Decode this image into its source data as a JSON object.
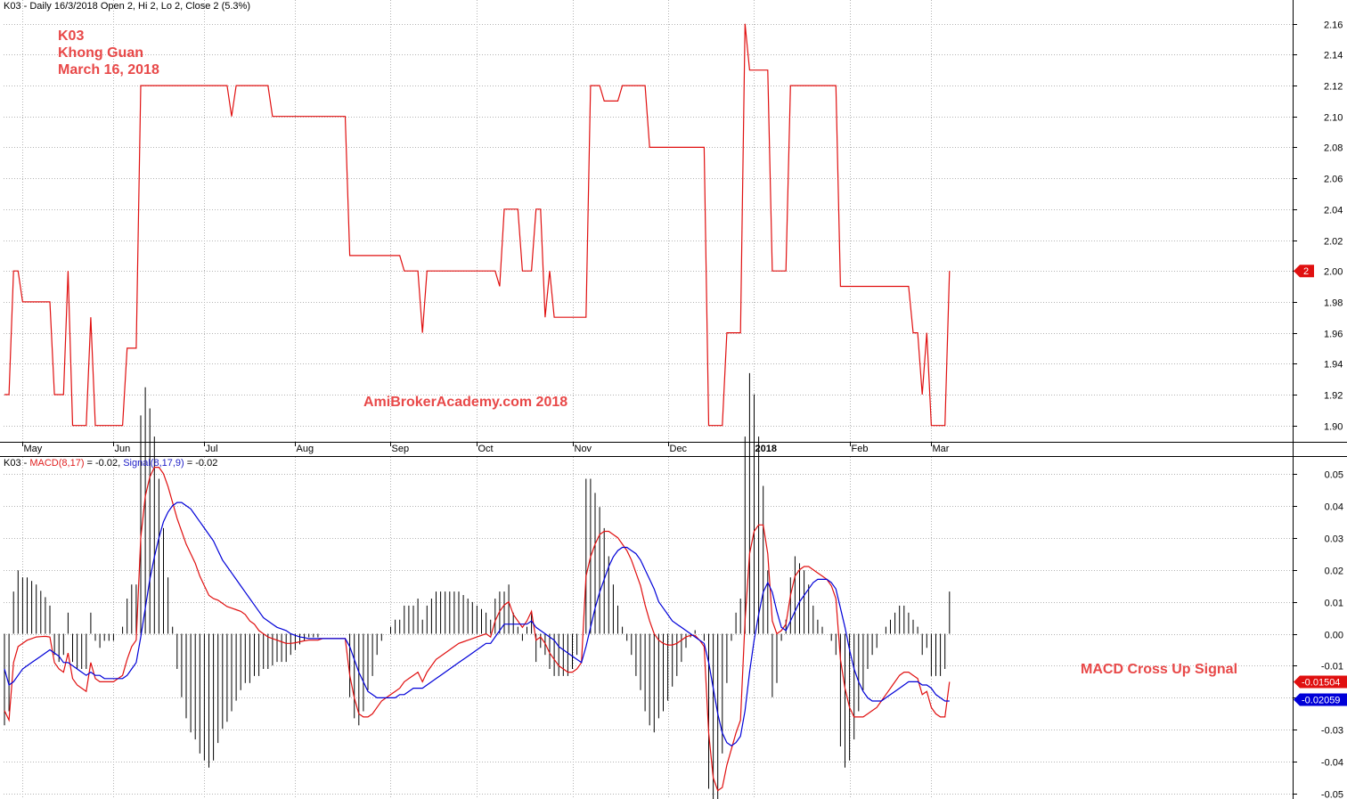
{
  "price_header": {
    "symbol": "K03",
    "info": " - Daily 16/3/2018 Open 2, Hi 2, Lo 2, Close 2 (5.3%)"
  },
  "annotation": {
    "line1": "K03",
    "line2": "Khong Guan",
    "line3": "March 16, 2018",
    "watermark": "AmiBrokerAcademy.com  2018",
    "signal": "MACD Cross Up Signal"
  },
  "macd_header": {
    "symbol": "K03",
    "sep1": " - ",
    "macd_label": "MACD(8,17)",
    "macd_value": " = -0.02, ",
    "signal_label": "Signal(8,17,9)",
    "signal_value": " = -0.02"
  },
  "colors": {
    "price": "#e01010",
    "macd": "#e01010",
    "signal": "#0000d8",
    "histogram": "#000000",
    "grid": "#b4b4b4",
    "last_price_tag": "#e01010",
    "last_signal_tag": "#0000d8"
  },
  "chart_data": [
    {
      "type": "line",
      "name": "price",
      "ylim": [
        1.89,
        2.165
      ],
      "yticks": [
        "1.90",
        "1.92",
        "1.94",
        "1.96",
        "1.98",
        "2.00",
        "2.02",
        "2.04",
        "2.06",
        "2.08",
        "2.10",
        "2.12",
        "2.14",
        "2.16"
      ],
      "months": [
        {
          "label": "May",
          "bar": 4,
          "bold": false
        },
        {
          "label": "Jun",
          "bar": 24,
          "bold": false
        },
        {
          "label": "Jul",
          "bar": 44,
          "bold": false
        },
        {
          "label": "Aug",
          "bar": 64,
          "bold": false
        },
        {
          "label": "Sep",
          "bar": 85,
          "bold": false
        },
        {
          "label": "Oct",
          "bar": 104,
          "bold": false
        },
        {
          "label": "Nov",
          "bar": 125,
          "bold": false
        },
        {
          "label": "Dec",
          "bar": 146,
          "bold": false
        },
        {
          "label": "2018",
          "bar": 165,
          "bold": true
        },
        {
          "label": "Feb",
          "bar": 186,
          "bold": false
        },
        {
          "label": "Mar",
          "bar": 204,
          "bold": false
        }
      ],
      "last_value_label": "2",
      "last_value": 2.0,
      "values": [
        1.92,
        1.92,
        2.0,
        2.0,
        1.98,
        1.98,
        1.98,
        1.98,
        1.98,
        1.98,
        1.98,
        1.92,
        1.92,
        1.92,
        2.0,
        1.9,
        1.9,
        1.9,
        1.9,
        1.97,
        1.9,
        1.9,
        1.9,
        1.9,
        1.9,
        1.9,
        1.9,
        1.95,
        1.95,
        1.95,
        2.12,
        2.12,
        2.12,
        2.12,
        2.12,
        2.12,
        2.12,
        2.12,
        2.12,
        2.12,
        2.12,
        2.12,
        2.12,
        2.12,
        2.12,
        2.12,
        2.12,
        2.12,
        2.12,
        2.12,
        2.1,
        2.12,
        2.12,
        2.12,
        2.12,
        2.12,
        2.12,
        2.12,
        2.12,
        2.1,
        2.1,
        2.1,
        2.1,
        2.1,
        2.1,
        2.1,
        2.1,
        2.1,
        2.1,
        2.1,
        2.1,
        2.1,
        2.1,
        2.1,
        2.1,
        2.1,
        2.01,
        2.01,
        2.01,
        2.01,
        2.01,
        2.01,
        2.01,
        2.01,
        2.01,
        2.01,
        2.01,
        2.01,
        2.0,
        2.0,
        2.0,
        2.0,
        1.96,
        2.0,
        2.0,
        2.0,
        2.0,
        2.0,
        2.0,
        2.0,
        2.0,
        2.0,
        2.0,
        2.0,
        2.0,
        2.0,
        2.0,
        2.0,
        2.0,
        1.99,
        2.04,
        2.04,
        2.04,
        2.04,
        2.0,
        2.0,
        2.0,
        2.04,
        2.04,
        1.97,
        2.0,
        1.97,
        1.97,
        1.97,
        1.97,
        1.97,
        1.97,
        1.97,
        1.97,
        2.12,
        2.12,
        2.12,
        2.11,
        2.11,
        2.11,
        2.11,
        2.12,
        2.12,
        2.12,
        2.12,
        2.12,
        2.12,
        2.08,
        2.08,
        2.08,
        2.08,
        2.08,
        2.08,
        2.08,
        2.08,
        2.08,
        2.08,
        2.08,
        2.08,
        2.08,
        1.9,
        1.9,
        1.9,
        1.9,
        1.96,
        1.96,
        1.96,
        1.96,
        2.16,
        2.13,
        2.13,
        2.13,
        2.13,
        2.13,
        2.0,
        2.0,
        2.0,
        2.0,
        2.12,
        2.12,
        2.12,
        2.12,
        2.12,
        2.12,
        2.12,
        2.12,
        2.12,
        2.12,
        2.12,
        1.99,
        1.99,
        1.99,
        1.99,
        1.99,
        1.99,
        1.99,
        1.99,
        1.99,
        1.99,
        1.99,
        1.99,
        1.99,
        1.99,
        1.99,
        1.99,
        1.96,
        1.96,
        1.92,
        1.96,
        1.9,
        1.9,
        1.9,
        1.9,
        2.0
      ]
    },
    {
      "type": "line",
      "name": "MACD",
      "ylim": [
        -0.0505,
        0.0505
      ],
      "yticks": [
        "-0.05",
        "-0.04",
        "-0.03",
        "-0.02",
        "-0.01",
        "0.00",
        "0.01",
        "0.02",
        "0.03",
        "0.04",
        "0.05"
      ],
      "last_macd_label": "-0.01504",
      "last_macd_value": -0.01504,
      "last_signal_label": "-0.02059",
      "last_signal_value": -0.02059,
      "macd": [
        -0.024,
        -0.027,
        -0.009,
        -0.004,
        -0.003,
        -0.002,
        -0.0015,
        -0.001,
        -0.0009,
        -0.0008,
        -0.001,
        -0.009,
        -0.011,
        -0.012,
        -0.006,
        -0.014,
        -0.016,
        -0.017,
        -0.018,
        -0.009,
        -0.014,
        -0.015,
        -0.015,
        -0.015,
        -0.015,
        -0.014,
        -0.013,
        -0.008,
        -0.004,
        -0.002,
        0.03,
        0.043,
        0.049,
        0.052,
        0.052,
        0.05,
        0.046,
        0.041,
        0.036,
        0.032,
        0.028,
        0.025,
        0.022,
        0.018,
        0.015,
        0.012,
        0.011,
        0.0105,
        0.0095,
        0.0085,
        0.008,
        0.0075,
        0.007,
        0.006,
        0.004,
        0.003,
        0.001,
        0.0,
        -0.001,
        -0.0015,
        -0.002,
        -0.0025,
        -0.003,
        -0.003,
        -0.0028,
        -0.0025,
        -0.0022,
        -0.002,
        -0.002,
        -0.002,
        -0.0015,
        -0.0015,
        -0.0015,
        -0.0015,
        -0.0015,
        -0.0015,
        -0.013,
        -0.02,
        -0.025,
        -0.026,
        -0.026,
        -0.025,
        -0.023,
        -0.021,
        -0.02,
        -0.019,
        -0.018,
        -0.017,
        -0.015,
        -0.014,
        -0.013,
        -0.012,
        -0.015,
        -0.012,
        -0.01,
        -0.008,
        -0.007,
        -0.006,
        -0.005,
        -0.004,
        -0.003,
        -0.0025,
        -0.002,
        -0.0015,
        -0.001,
        -0.0005,
        0.0,
        -0.001,
        0.004,
        0.007,
        0.009,
        0.01,
        0.006,
        0.004,
        0.002,
        0.004,
        0.007,
        -0.002,
        -0.001,
        -0.003,
        -0.006,
        -0.008,
        -0.01,
        -0.011,
        -0.012,
        -0.012,
        -0.011,
        -0.009,
        0.018,
        0.024,
        0.028,
        0.031,
        0.032,
        0.032,
        0.031,
        0.03,
        0.028,
        0.026,
        0.023,
        0.019,
        0.015,
        0.009,
        0.004,
        0.0,
        -0.002,
        -0.003,
        -0.0035,
        -0.0035,
        -0.003,
        -0.002,
        -0.001,
        -0.0005,
        -0.0005,
        -0.002,
        -0.004,
        -0.031,
        -0.045,
        -0.049,
        -0.048,
        -0.041,
        -0.036,
        -0.031,
        -0.027,
        0.004,
        0.025,
        0.032,
        0.034,
        0.034,
        0.025,
        0.004,
        0.0,
        0.001,
        0.003,
        0.012,
        0.018,
        0.02,
        0.021,
        0.021,
        0.02,
        0.019,
        0.018,
        0.017,
        0.015,
        0.011,
        -0.008,
        -0.017,
        -0.023,
        -0.026,
        -0.026,
        -0.026,
        -0.025,
        -0.024,
        -0.023,
        -0.021,
        -0.019,
        -0.017,
        -0.015,
        -0.013,
        -0.012,
        -0.012,
        -0.013,
        -0.014,
        -0.019,
        -0.018,
        -0.023,
        -0.025,
        -0.026,
        -0.026,
        -0.015
      ],
      "signal": [
        -0.011,
        -0.016,
        -0.015,
        -0.013,
        -0.011,
        -0.01,
        -0.009,
        -0.008,
        -0.007,
        -0.006,
        -0.005,
        -0.006,
        -0.007,
        -0.009,
        -0.009,
        -0.01,
        -0.011,
        -0.012,
        -0.013,
        -0.012,
        -0.013,
        -0.013,
        -0.014,
        -0.014,
        -0.014,
        -0.014,
        -0.014,
        -0.013,
        -0.011,
        -0.009,
        -0.001,
        0.008,
        0.017,
        0.024,
        0.03,
        0.035,
        0.038,
        0.04,
        0.041,
        0.041,
        0.04,
        0.039,
        0.037,
        0.035,
        0.033,
        0.031,
        0.029,
        0.026,
        0.023,
        0.021,
        0.019,
        0.017,
        0.015,
        0.013,
        0.011,
        0.009,
        0.007,
        0.005,
        0.004,
        0.003,
        0.002,
        0.0015,
        0.001,
        0.0,
        -0.0005,
        -0.001,
        -0.0012,
        -0.0015,
        -0.0015,
        -0.0015,
        -0.0015,
        -0.0015,
        -0.0015,
        -0.0015,
        -0.0015,
        -0.0015,
        -0.004,
        -0.008,
        -0.012,
        -0.015,
        -0.018,
        -0.019,
        -0.02,
        -0.02,
        -0.02,
        -0.02,
        -0.02,
        -0.019,
        -0.019,
        -0.018,
        -0.017,
        -0.017,
        -0.017,
        -0.016,
        -0.015,
        -0.014,
        -0.013,
        -0.012,
        -0.011,
        -0.01,
        -0.009,
        -0.008,
        -0.007,
        -0.006,
        -0.005,
        -0.004,
        -0.003,
        -0.003,
        -0.001,
        0.001,
        0.003,
        0.003,
        0.003,
        0.003,
        0.003,
        0.003,
        0.004,
        0.002,
        0.001,
        0.0,
        -0.001,
        -0.002,
        -0.004,
        -0.005,
        -0.006,
        -0.007,
        -0.008,
        -0.009,
        -0.004,
        0.002,
        0.008,
        0.013,
        0.017,
        0.021,
        0.024,
        0.026,
        0.027,
        0.027,
        0.026,
        0.025,
        0.023,
        0.02,
        0.017,
        0.014,
        0.01,
        0.008,
        0.006,
        0.004,
        0.003,
        0.002,
        0.001,
        0.0,
        -0.001,
        -0.002,
        -0.003,
        -0.009,
        -0.017,
        -0.025,
        -0.031,
        -0.034,
        -0.035,
        -0.034,
        -0.032,
        -0.024,
        -0.012,
        -0.002,
        0.006,
        0.013,
        0.016,
        0.013,
        0.007,
        0.002,
        0.001,
        0.004,
        0.007,
        0.01,
        0.012,
        0.014,
        0.016,
        0.017,
        0.017,
        0.017,
        0.016,
        0.014,
        0.008,
        0.002,
        -0.005,
        -0.011,
        -0.015,
        -0.018,
        -0.02,
        -0.021,
        -0.021,
        -0.021,
        -0.02,
        -0.019,
        -0.018,
        -0.017,
        -0.016,
        -0.015,
        -0.015,
        -0.015,
        -0.016,
        -0.016,
        -0.017,
        -0.019,
        -0.02,
        -0.021,
        -0.021
      ]
    }
  ]
}
